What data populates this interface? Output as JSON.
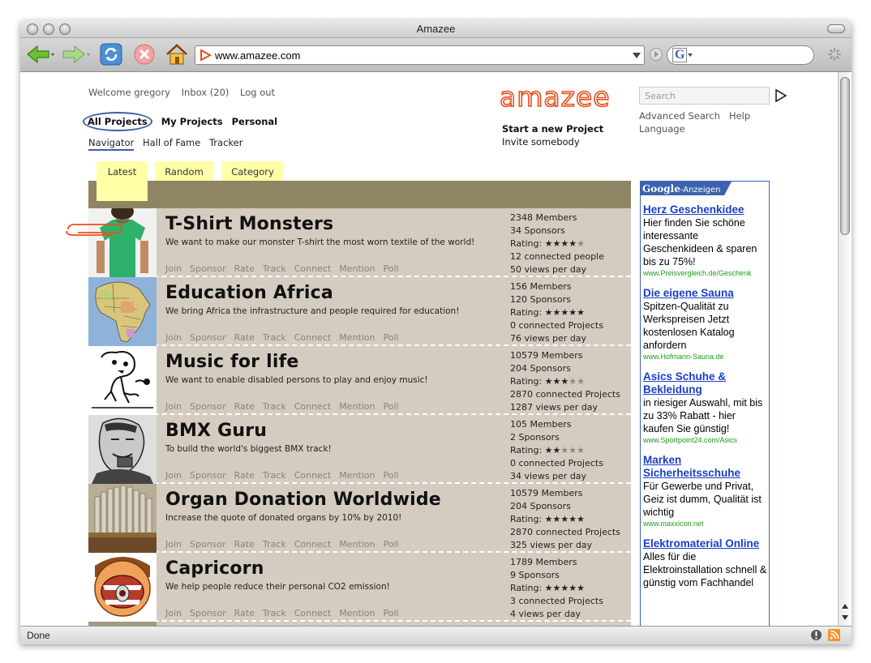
{
  "browser": {
    "title": "Amazee",
    "url": "www.amazee.com",
    "search_engine_label": "G",
    "status": "Done"
  },
  "header": {
    "welcome": "Welcome gregory",
    "inbox": "Inbox (20)",
    "logout": "Log out",
    "logo_text": "amazee",
    "search_placeholder": "Search",
    "advanced_search": "Advanced Search",
    "help": "Help",
    "language": "Language",
    "start_project": "Start a new Project",
    "invite": "Invite somebody"
  },
  "nav": {
    "primary": [
      "All Projects",
      "My Projects",
      "Personal"
    ],
    "secondary": [
      "Navigator",
      "Hall of Fame",
      "Tracker"
    ]
  },
  "tabs": [
    "Latest",
    "Random",
    "Category"
  ],
  "actions": [
    "Join",
    "Sponsor",
    "Rate",
    "Track",
    "Connect",
    "Mention",
    "Poll"
  ],
  "projects": [
    {
      "title": "T-Shirt Monsters",
      "desc": "We want to make our monster T-shirt the most worn textile of the world!",
      "members": "2348 Members",
      "sponsors": "34 Sponsors",
      "rating_label": "Rating:",
      "rating": 4,
      "connected": "12 connected people",
      "views": "50 views per day"
    },
    {
      "title": "Education Africa",
      "desc": "We bring Africa the infrastructure and people required for education!",
      "members": "156 Members",
      "sponsors": "120 Sponsors",
      "rating_label": "Rating:",
      "rating": 5,
      "connected": "0 connected Projects",
      "views": "76 views per day"
    },
    {
      "title": "Music for life",
      "desc": "We want to enable disabled persons to play and enjoy music!",
      "members": "10579 Members",
      "sponsors": "204 Sponsors",
      "rating_label": "Rating:",
      "rating": 3,
      "connected": "2870 connected Projects",
      "views": "1287 views per day"
    },
    {
      "title": "BMX Guru",
      "desc": "To build the world's biggest BMX track!",
      "members": "105 Members",
      "sponsors": "2 Sponsors",
      "rating_label": "Rating:",
      "rating": 2,
      "connected": "0 connected Projects",
      "views": "34 views per day"
    },
    {
      "title": "Organ Donation Worldwide",
      "desc": "Increase the quote of donated organs by 10% by 2010!",
      "members": "10579 Members",
      "sponsors": "204 Sponsors",
      "rating_label": "Rating:",
      "rating": 5,
      "connected": "2870 connected Projects",
      "views": "325 views per day"
    },
    {
      "title": "Capricorn",
      "desc": "We help people reduce their personal CO2 emission!",
      "members": "1789 Members",
      "sponsors": "9 Sponsors",
      "rating_label": "Rating:",
      "rating": 5,
      "connected": "3 connected Projects",
      "views": "4 views per day"
    }
  ],
  "ads": {
    "header_brand": "Google",
    "header_label": "-Anzeigen",
    "items": [
      {
        "title": "Herz Geschenkidee",
        "text": "Hier finden Sie schöne interessante Geschenkideen & sparen bis zu 75%!",
        "url": "www.Preisvergleich.de/Geschenk"
      },
      {
        "title": "Die eigene Sauna",
        "text": "Spitzen-Qualität zu Werkspreisen Jetzt kostenlosen Katalog anfordern",
        "url": "www.Hofmann-Sauna.de"
      },
      {
        "title": "Asics Schuhe & Bekleidung",
        "text": "in riesiger Auswahl, mit bis zu 33% Rabatt - hier kaufen Sie günstig!",
        "url": "www.Sportpoint24.com/Asics"
      },
      {
        "title": "Marken Sicherheitsschuhe",
        "text": "Für Gewerbe und Privat, Geiz ist dumm, Qualität ist wichtig",
        "url": "www.maxxicon.net"
      },
      {
        "title": "Elektromaterial Online",
        "text": "Alles für die Elektroinstallation schnell & günstig vom Fachhandel",
        "url": ""
      }
    ]
  },
  "colors": {
    "brand_orange": "#e8501c",
    "tab_yellow": "#ffffa8",
    "ad_blue": "#3c63ad",
    "ad_link": "#1a3ec8",
    "ad_url_green": "#1a9b1a",
    "paper": "#d4ccc0"
  }
}
